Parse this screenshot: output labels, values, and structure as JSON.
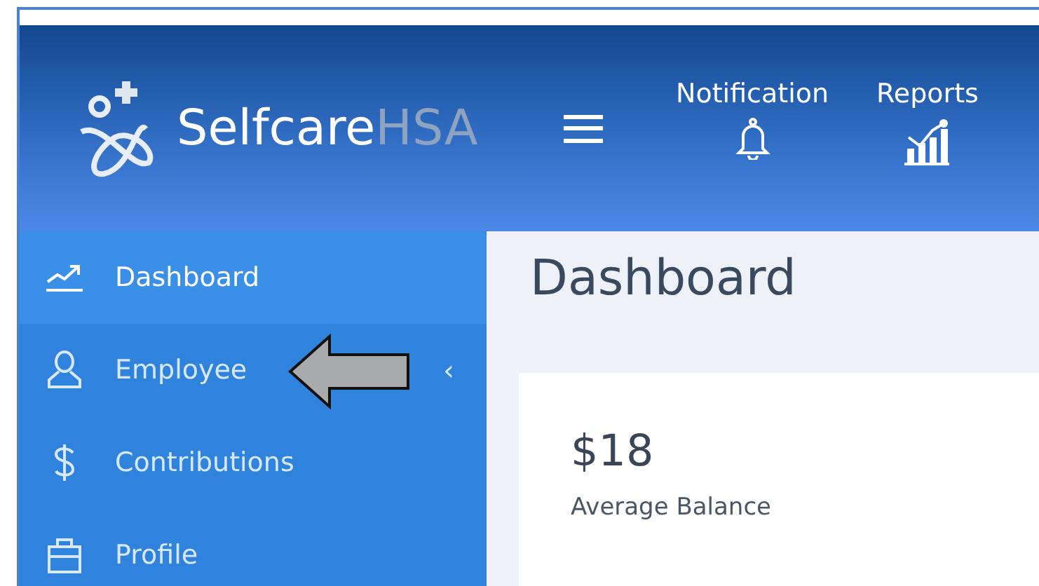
{
  "header": {
    "brand": "Selfcare",
    "brand_suffix": "HSA",
    "actions": [
      {
        "label": "Notification",
        "kind": "bell"
      },
      {
        "label": "Reports",
        "kind": "chart"
      }
    ]
  },
  "sidebar": {
    "items": [
      {
        "label": "Dashboard",
        "kind": "trend",
        "selected": true
      },
      {
        "label": "Employee",
        "kind": "user",
        "selected": false,
        "chevron": "‹"
      },
      {
        "label": "Contributions",
        "kind": "dollar",
        "selected": false
      },
      {
        "label": "Profile",
        "kind": "briefcase",
        "selected": false
      }
    ]
  },
  "content": {
    "title": "Dashboard",
    "card": {
      "value": "$18",
      "label": "Average Balance"
    }
  }
}
